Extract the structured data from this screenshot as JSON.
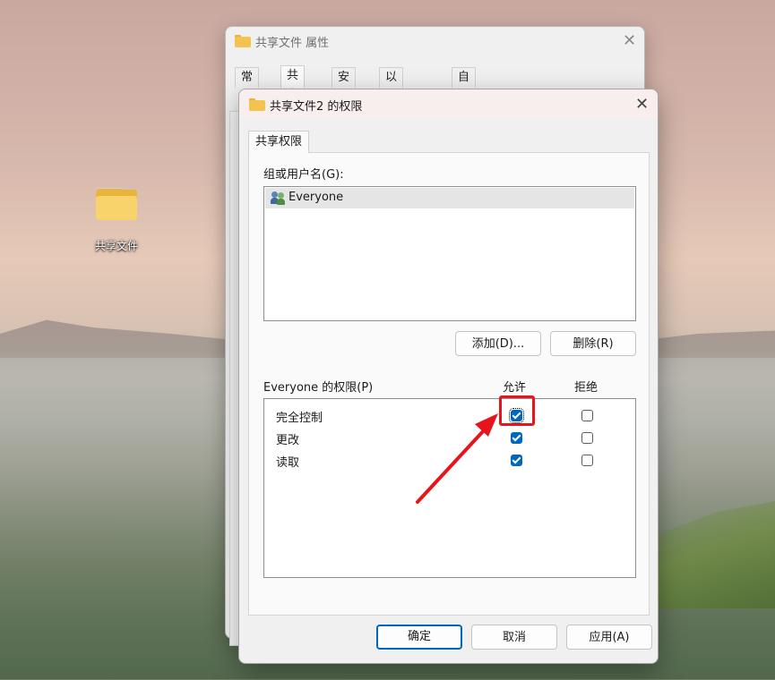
{
  "desktop": {
    "icon_label": "共享文件"
  },
  "back_window": {
    "title": "共享文件 属性",
    "tabs": [
      "常规",
      "共享",
      "安全",
      "以前的版本",
      "自定义"
    ]
  },
  "dialog": {
    "title": "共享文件2 的权限",
    "tab": "共享权限",
    "group_label": "组或用户名(G):",
    "users": [
      "Everyone"
    ],
    "add_button": "添加(D)...",
    "remove_button": "删除(R)",
    "perm_label": "Everyone 的权限(P)",
    "allow_header": "允许",
    "deny_header": "拒绝",
    "permissions": [
      {
        "name": "完全控制",
        "allow": true,
        "deny": false
      },
      {
        "name": "更改",
        "allow": true,
        "deny": false
      },
      {
        "name": "读取",
        "allow": true,
        "deny": false
      }
    ],
    "ok_button": "确定",
    "cancel_button": "取消",
    "apply_button": "应用(A)"
  },
  "annotation": {
    "highlight_color": "#e8141b"
  },
  "colors": {
    "accent": "#0067c0"
  }
}
